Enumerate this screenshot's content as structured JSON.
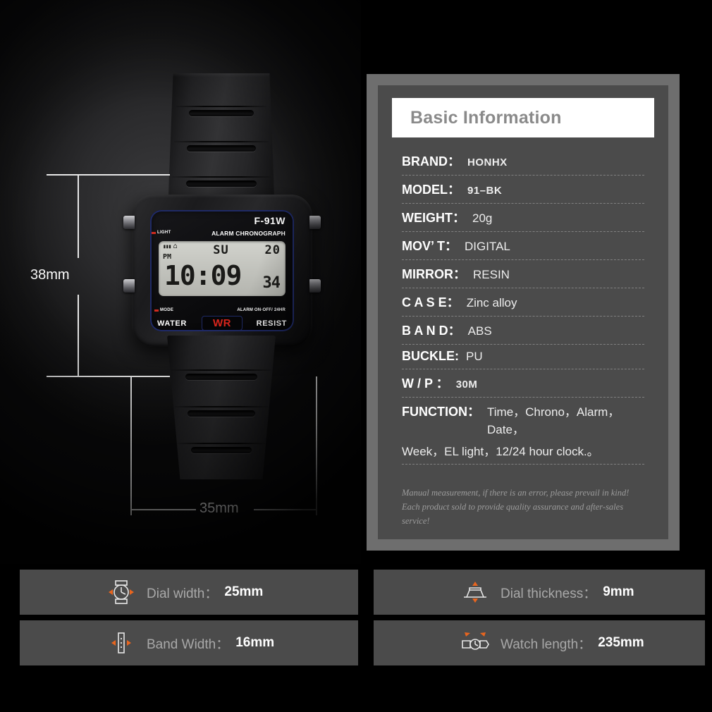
{
  "photo": {
    "watch": {
      "model_text": "F-91W",
      "subtitle_text": "ALARM CHRONOGRAPH",
      "light_label": "LIGHT",
      "mode_label": "MODE",
      "alarm_label": "ALARM  ON·OFF/ 24HR",
      "water_label": "WATER",
      "resist_label": "RESIST",
      "wr_label": "WR",
      "lcd": {
        "battery": "▮▮▮",
        "bell": "⌂",
        "day": "SU",
        "date": "20",
        "meridiem": "PM",
        "time": "10:09",
        "seconds": "34"
      }
    },
    "dimensions": {
      "height_label": "38mm",
      "width_label": "35mm"
    }
  },
  "spec_panel": {
    "header": "Basic Information",
    "rows": [
      {
        "key": "BRAND：",
        "value": "HONHX",
        "bold": true
      },
      {
        "key": "MODEL：",
        "value": "91–BK",
        "bold": true
      },
      {
        "key": "WEIGHT：",
        "value": "20g",
        "bold": false
      },
      {
        "key": "MOV’ T：",
        "value": "DIGITAL",
        "bold": false
      },
      {
        "key": "MIRROR：",
        "value": "RESIN",
        "bold": false
      },
      {
        "key": "C A S E：",
        "value": "Zinc alloy",
        "bold": false
      },
      {
        "key": "B A N D：",
        "value": "ABS",
        "bold": false
      },
      {
        "key": "BUCKLE:",
        "value": "PU",
        "bold": false
      },
      {
        "key": "W / P ：",
        "value": "30M",
        "bold": true
      }
    ],
    "function": {
      "key": "FUNCTION：",
      "line1": "Time，Chrono，Alarm，Date，",
      "line2": "Week，EL light，12/24 hour clock.。"
    },
    "note_line1": "Manual measurement, if there is an error, please prevail in kind!",
    "note_line2": "Each product sold to provide quality assurance and after-sales service!"
  },
  "feature_cards": [
    {
      "icon": "watch-front-icon",
      "label": "Dial width：",
      "value": "25mm"
    },
    {
      "icon": "watch-side-icon",
      "label": "Dial thickness：",
      "value": "9mm"
    },
    {
      "icon": "band-width-icon",
      "label": "Band Width：",
      "value": "16mm"
    },
    {
      "icon": "watch-length-icon",
      "label": "Watch length：",
      "value": "235mm"
    }
  ],
  "colors": {
    "background": "#000000",
    "panel_outer": "#6e6e6e",
    "panel_inner": "#4b4b4b",
    "header_bg": "#ffffff",
    "header_text": "#8a8a8a",
    "accent_orange": "#e8651f",
    "lcd_red": "#d8251c",
    "bezel_blue": "#1f2a66"
  }
}
